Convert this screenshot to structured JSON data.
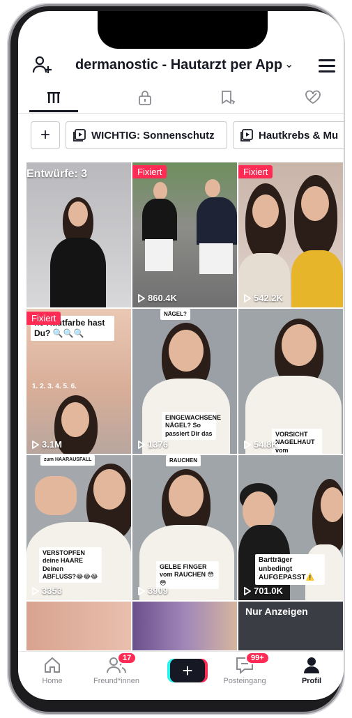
{
  "header": {
    "title": "dermanostic - Hautarzt per App",
    "chevron": "⌄"
  },
  "tabs": [
    {
      "icon": "grid-icon",
      "active": true
    },
    {
      "icon": "lock-icon",
      "active": false
    },
    {
      "icon": "bookmark-icon",
      "active": false
    },
    {
      "icon": "heart-icon",
      "active": false
    }
  ],
  "collections": {
    "add_label": "+",
    "items": [
      {
        "label": "WICHTIG: Sonnenschutz"
      },
      {
        "label": "Hautkrebs & Mu"
      }
    ]
  },
  "grid": {
    "drafts_label": "Entwürfe: 3",
    "pinned_label": "Fixiert",
    "videos": [
      {
        "views": "860.4K"
      },
      {
        "views": "542.2K"
      },
      {
        "views": "3.1M",
        "caption": "he Hautfarbe hast Du? 🔍🔍🔍",
        "numbers": "1.   2.   3.   4.   5.   6."
      },
      {
        "views": "1376",
        "caption": "EINGEWACHSENE NÄGEL? So passiert Dir das",
        "top": "NÄGEL?"
      },
      {
        "views": "54.8K",
        "caption": "VORSICHT NAGELHAUT vom",
        "top": ""
      },
      {
        "views": "3353",
        "caption": "VERSTOPFEN deine HAARE Deinen ABFLUSS?😂😂😂",
        "top": "zum HAARAUSFALL"
      },
      {
        "views": "3909",
        "caption": "GELBE FINGER vom RAUCHEN 😳😳",
        "top": "RAUCHEN"
      },
      {
        "views": "701.0K",
        "caption": "Bartträger unbedingt AUFGEPASST⚠️"
      }
    ],
    "ads_label": "Nur Anzeigen"
  },
  "bottom_nav": [
    {
      "label": "Home",
      "icon": "home-icon"
    },
    {
      "label": "Freund*innen",
      "icon": "friends-icon",
      "badge": "17"
    },
    {
      "label": "+",
      "icon": "create-icon"
    },
    {
      "label": "Posteingang",
      "icon": "inbox-icon",
      "badge": "99+"
    },
    {
      "label": "Profil",
      "icon": "profile-icon",
      "active": true
    }
  ],
  "colors": {
    "accent": "#fe2c55",
    "cyan": "#25f4ee",
    "text": "#161823"
  }
}
